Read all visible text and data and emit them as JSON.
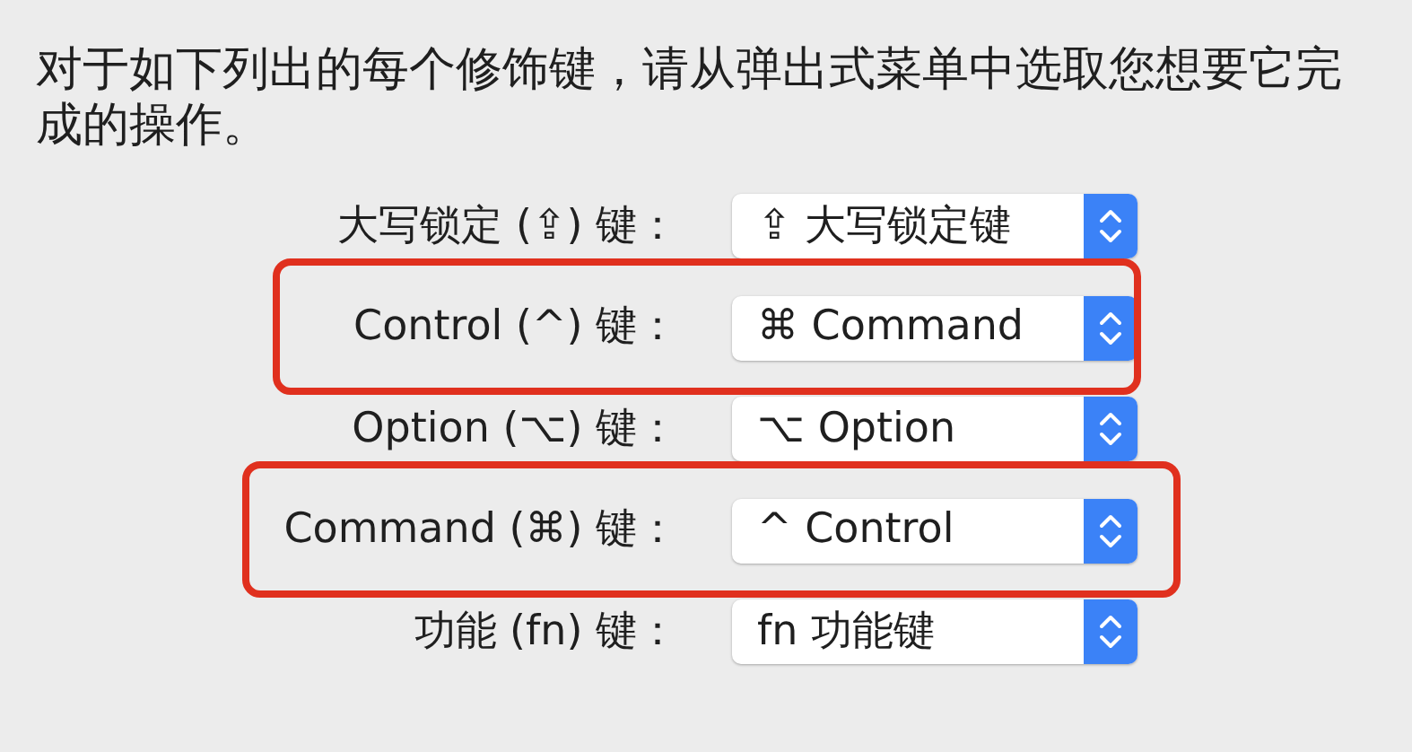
{
  "instruction": "对于如下列出的每个修饰键，请从弹出式菜单中选取您想要它完成的操作。",
  "rows": [
    {
      "label": "大写锁定 (⇪) 键：",
      "value": "⇪ 大写锁定键",
      "highlighted": false
    },
    {
      "label": "Control (^) 键：",
      "value": "⌘ Command",
      "highlighted": true
    },
    {
      "label": "Option (⌥) 键：",
      "value": "⌥ Option",
      "highlighted": false
    },
    {
      "label": "Command (⌘) 键：",
      "value": "^ Control",
      "highlighted": true
    },
    {
      "label": "功能 (fn) 键：",
      "value": "fn 功能键",
      "highlighted": false
    }
  ]
}
